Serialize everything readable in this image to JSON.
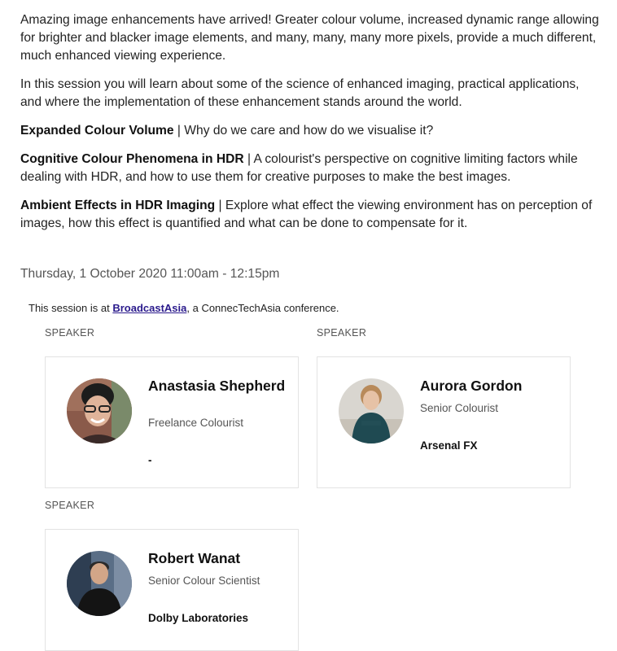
{
  "description": {
    "intro": "Amazing image enhancements have arrived! Greater colour volume, increased dynamic range allowing for brighter and blacker image elements, and many, many, many more pixels, provide a much different, much enhanced viewing experience.",
    "session_info": "In this session you will learn about some of the science of enhanced imaging, practical applications, and where the implementation of these enhancement stands around the world.",
    "topics": [
      {
        "title": "Expanded Colour Volume",
        "text": " | Why do we care and how do we visualise it?"
      },
      {
        "title": "Cognitive Colour Phenomena in HDR",
        "text": " | A colourist's perspective on cognitive limiting factors while dealing with HDR, and how to use them for creative purposes to make the best images."
      },
      {
        "title": "Ambient Effects in HDR Imaging",
        "text": " | Explore what effect the viewing environment has on perception of images, how this effect is quantified and what can be done to compensate for it."
      }
    ]
  },
  "datetime": "Thursday, 1 October 2020 11:00am - 12:15pm",
  "session_note": {
    "prefix": "This session is at ",
    "link": "BroadcastAsia",
    "suffix": ", a ConnecTechAsia conference."
  },
  "speakers": [
    {
      "label": "SPEAKER",
      "name": "Anastasia Shepherd",
      "role": "Freelance Colourist",
      "org": "-"
    },
    {
      "label": "SPEAKER",
      "name": "Aurora Gordon",
      "role": "Senior Colourist",
      "org": "Arsenal FX"
    },
    {
      "label": "SPEAKER",
      "name": "Robert Wanat",
      "role": "Senior Colour Scientist",
      "org": "Dolby Laboratories"
    }
  ],
  "colors": {
    "link": "#2a1a8c",
    "text": "#222222",
    "muted": "#555555",
    "card_border": "#e3e3e3"
  },
  "icons": {
    "speaker_photos": "avatar"
  }
}
